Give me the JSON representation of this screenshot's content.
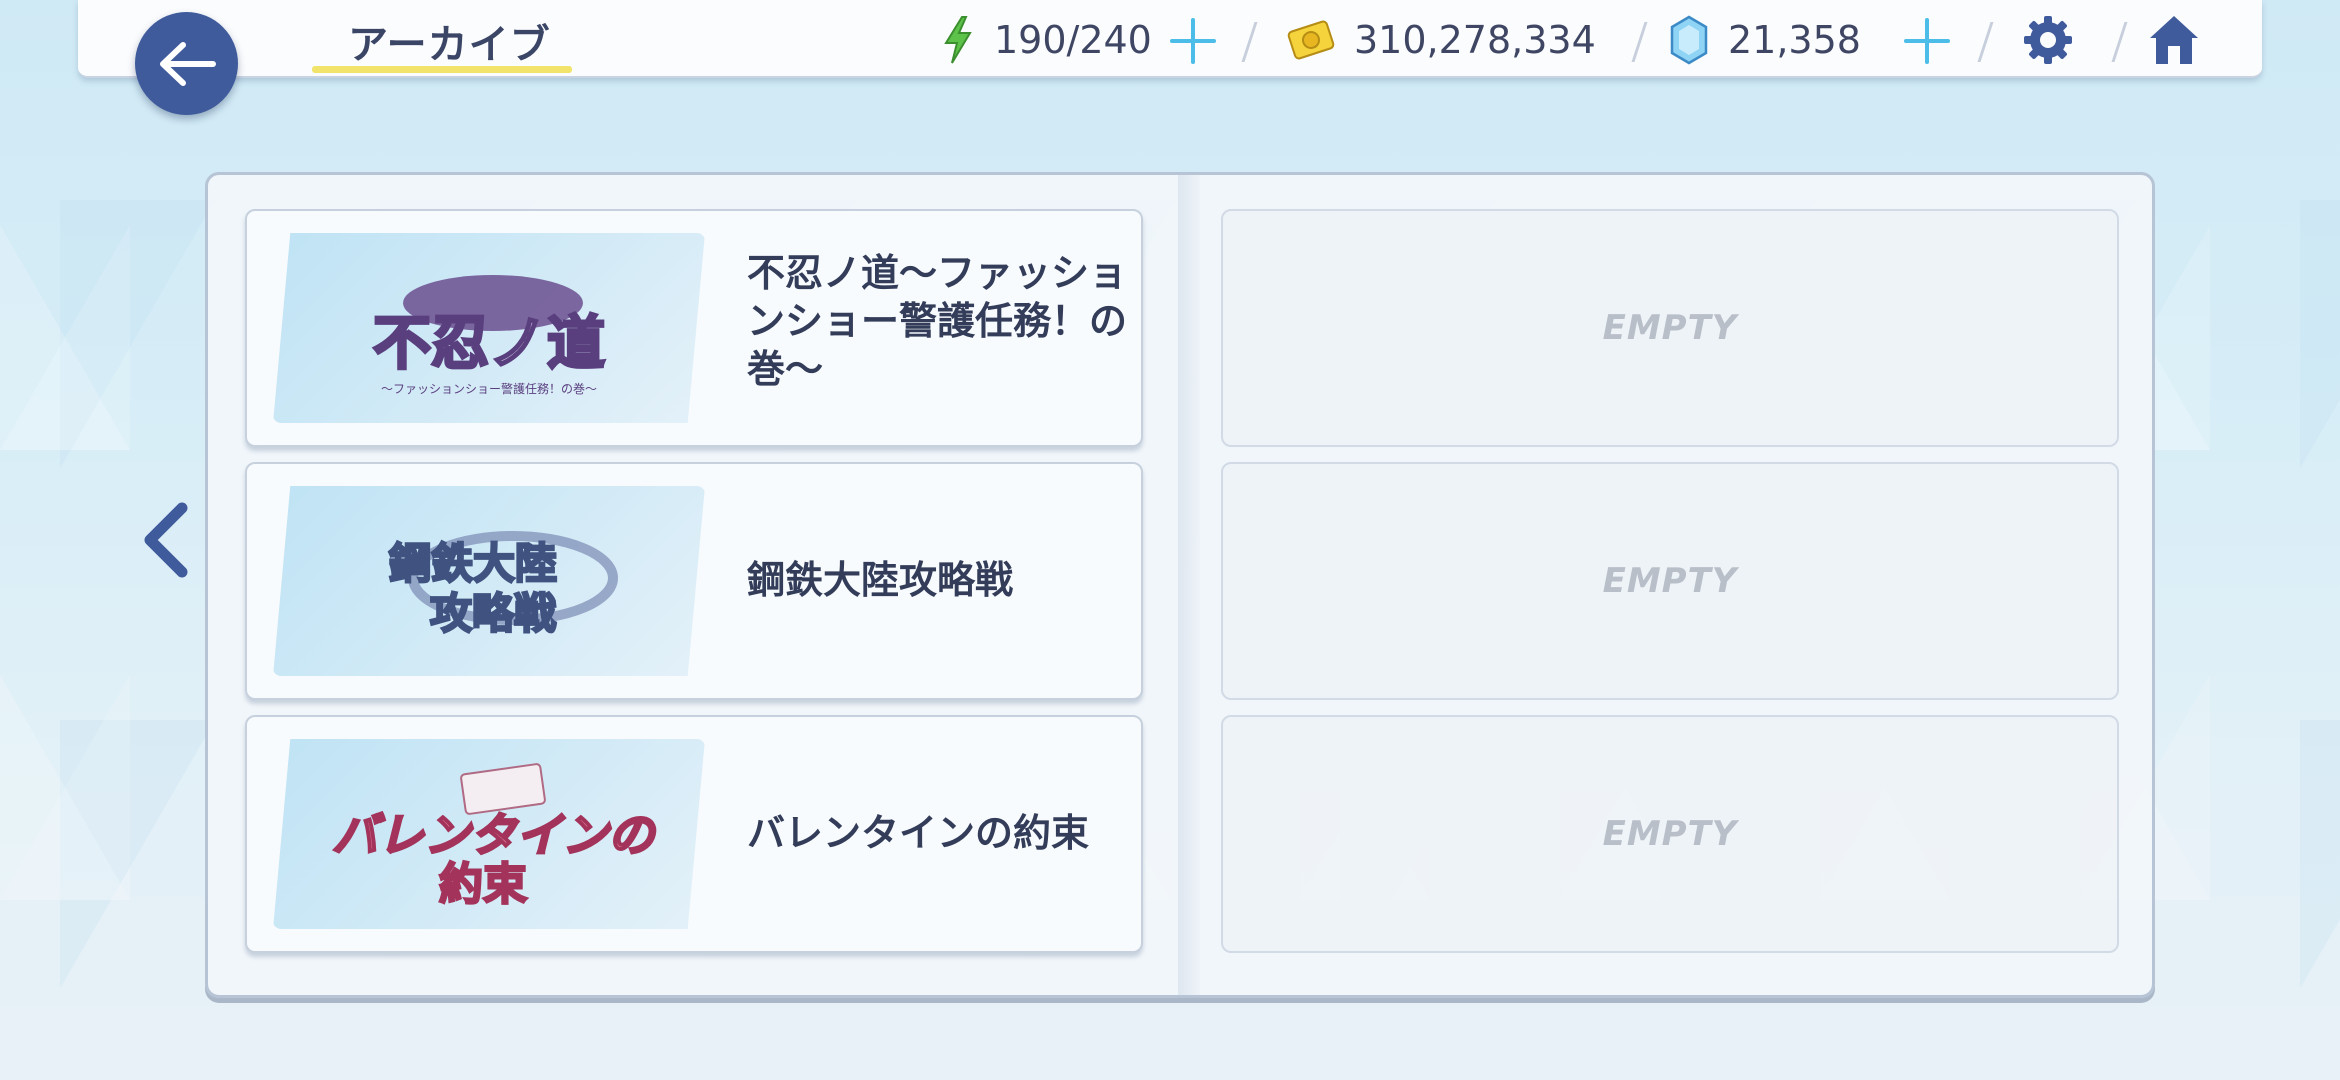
{
  "header": {
    "title": "アーカイブ",
    "stamina": "190/240",
    "mana": "310,278,334",
    "jewels": "21,358"
  },
  "cards": [
    {
      "title": "不忍ノ道〜ファッションショー警護任務！の巻〜",
      "banner_text": "不忍ノ道",
      "banner_sub": "〜ファッションショー警護任務！の巻〜"
    },
    {
      "title": "鋼鉄大陸攻略戦",
      "banner_text_1": "鋼鉄大陸",
      "banner_text_2": "攻略戦"
    },
    {
      "title": "バレンタインの約束",
      "banner_text_1": "バレンタインの",
      "banner_text_2": "約束"
    }
  ],
  "empty_slots": [
    "EMPTY",
    "EMPTY",
    "EMPTY"
  ],
  "colors": {
    "back_button": "#3f5b9c",
    "plus": "#4cbde9",
    "title_underline": "#f2e36a"
  }
}
